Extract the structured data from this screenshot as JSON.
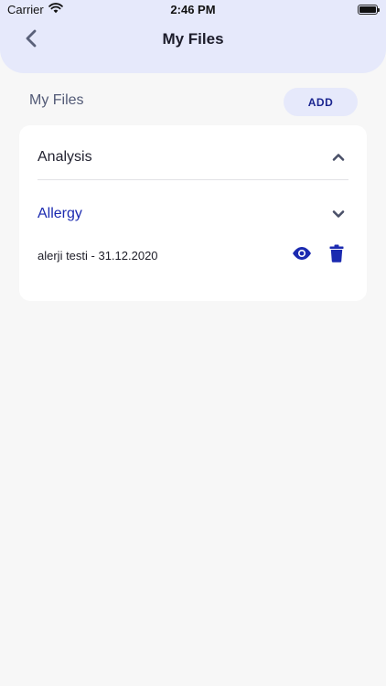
{
  "status_bar": {
    "carrier": "Carrier",
    "time": "2:46 PM",
    "battery_level": 1.0
  },
  "nav": {
    "title": "My Files",
    "back_icon": "chevron-left-icon"
  },
  "section": {
    "title": "My Files",
    "add_label": "ADD"
  },
  "groups": [
    {
      "label": "Analysis",
      "icon": "chevron-up-icon",
      "expanded": false
    },
    {
      "label": "Allergy",
      "icon": "chevron-down-icon",
      "expanded": true,
      "files": [
        {
          "name": "alerji testi - 31.12.2020",
          "actions": [
            "eye-icon",
            "trash-icon"
          ]
        }
      ]
    }
  ],
  "colors": {
    "header_bg": "#e6e9fb",
    "accent": "#1b2ab0",
    "background": "#f7f7f7"
  }
}
